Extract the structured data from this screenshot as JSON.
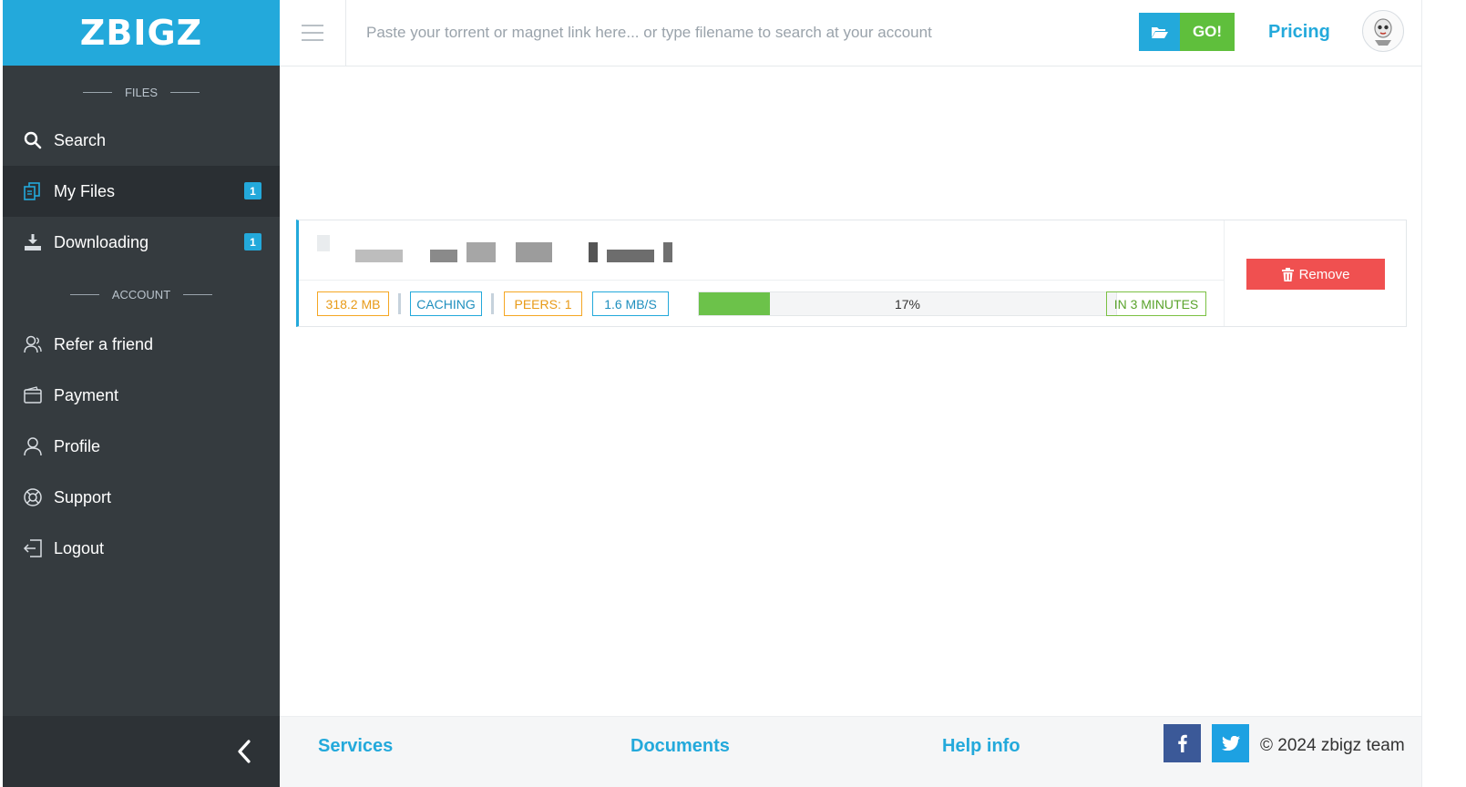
{
  "brand": {
    "logo_text": "ZBIGZ"
  },
  "sidebar": {
    "files_heading": "FILES",
    "account_heading": "ACCOUNT",
    "files_items": [
      {
        "label": "Search",
        "icon": "search-icon"
      },
      {
        "label": "My Files",
        "icon": "files-icon",
        "badge": "1",
        "active": true
      },
      {
        "label": "Downloading",
        "icon": "download-icon",
        "badge": "1"
      }
    ],
    "account_items": [
      {
        "label": "Refer a friend",
        "icon": "refer-friend-icon"
      },
      {
        "label": "Payment",
        "icon": "wallet-icon"
      },
      {
        "label": "Profile",
        "icon": "user-icon"
      },
      {
        "label": "Support",
        "icon": "lifebuoy-icon"
      },
      {
        "label": "Logout",
        "icon": "logout-icon"
      }
    ],
    "collapse_icon": "chevron-left-icon"
  },
  "topbar": {
    "search_placeholder": "Paste your torrent or magnet link here... or type filename to search at your account",
    "search_value": "",
    "folder_icon": "folder-open-icon",
    "go_label": "GO!",
    "pricing_label": "Pricing",
    "avatar_icon": "avatar-icon"
  },
  "file": {
    "name": "",
    "size": "318.2 MB",
    "status": "CACHING",
    "peers": "PEERS: 1",
    "speed": "1.6 MB/S",
    "progress": 0.17,
    "progress_label": "17%",
    "eta": "IN 3 MINUTES",
    "remove_label": "Remove",
    "remove_icon": "trash-icon"
  },
  "footer": {
    "links": [
      "Services",
      "Documents",
      "Help info"
    ],
    "facebook_icon": "facebook-icon",
    "twitter_icon": "twitter-icon",
    "copyright": "© 2024 zbigz team"
  },
  "colors": {
    "brand": "#23a9db",
    "sidebar_bg": "#353b3f",
    "go_green": "#5fbf3c",
    "remove_red": "#f05050",
    "size_orange": "#f5a623",
    "eta_green": "#7bc143"
  }
}
